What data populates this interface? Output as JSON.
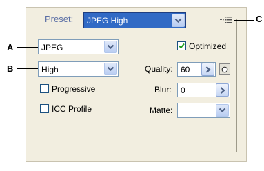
{
  "preset": {
    "label": "Preset:",
    "value": "JPEG High"
  },
  "format": {
    "value": "JPEG"
  },
  "compression": {
    "value": "High"
  },
  "optimized": {
    "label": "Optimized",
    "checked": true
  },
  "progressive": {
    "label": "Progressive",
    "checked": false
  },
  "icc_profile": {
    "label": "ICC Profile",
    "checked": false
  },
  "quality": {
    "label": "Quality:",
    "value": "60"
  },
  "blur": {
    "label": "Blur:",
    "value": "0"
  },
  "matte": {
    "label": "Matte:",
    "value": ""
  },
  "callouts": {
    "a": "A",
    "b": "B",
    "c": "C"
  },
  "colors": {
    "panel": "#f2eee0",
    "selection": "#316ac5",
    "label_blue": "#5a6ea5",
    "check_green": "#21a121"
  }
}
